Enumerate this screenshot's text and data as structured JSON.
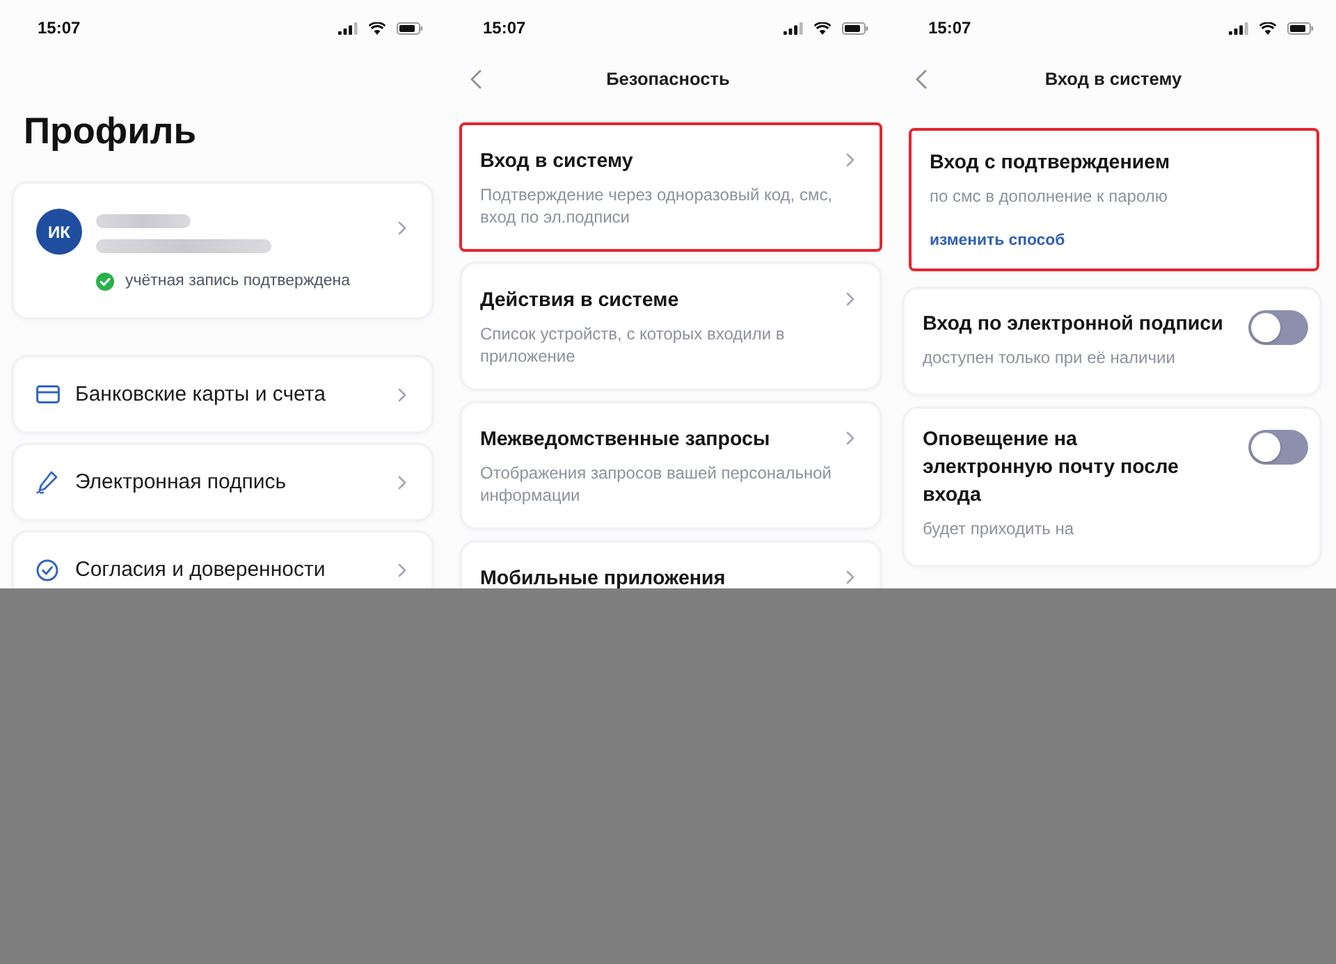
{
  "screens": [
    {
      "kind": "profile",
      "status_bar": {
        "time": "15:07"
      },
      "title": "Профиль",
      "profile_card": {
        "initials": "ИК",
        "name_hidden": true,
        "verified": true,
        "status": "учётная запись подтверждена"
      },
      "menu": [
        {
          "label": "Банковские карты и счета"
        },
        {
          "label": "Электронная подпись"
        },
        {
          "label": "Согласия и доверенности"
        }
      ]
    },
    {
      "kind": "list",
      "status_bar": {
        "time": "15:07"
      },
      "back": true,
      "title": "Безопасность",
      "items": [
        {
          "title": "Вход в систему",
          "description": "Подтверждение через одноразовый код, смс, вход по эл.подписи",
          "highlighted": true
        },
        {
          "title": "Действия в системе",
          "description": "Список устройств, с которых входили в приложение",
          "highlighted": false
        },
        {
          "title": "Межведомственные запросы",
          "description": "Отображения запросов вашей персональной информации",
          "highlighted": false
        },
        {
          "title": "Мобильные приложения",
          "highlighted": false
        }
      ]
    },
    {
      "kind": "settings",
      "status_bar": {
        "time": "15:07"
      },
      "back": true,
      "title": "Вход в систему",
      "method_card": {
        "title": "Вход с подтверждением",
        "description": "по смс в дополнение к паролю",
        "link": "изменить способ",
        "highlighted": true
      },
      "options": [
        {
          "title": "Вход по электронной подписи",
          "description": "доступен только при её наличии",
          "on": false
        },
        {
          "title": "Оповещение на электронную почту после входа",
          "description": "будет приходить на",
          "on": false
        }
      ]
    }
  ]
}
